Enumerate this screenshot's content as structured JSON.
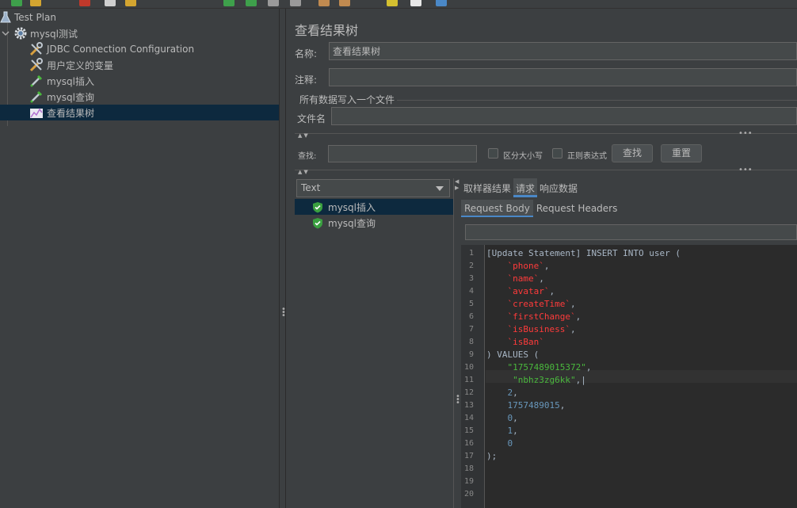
{
  "tree": {
    "items": [
      {
        "label": "Test Plan",
        "icon": "flask-icon"
      },
      {
        "label": "mysql测试",
        "icon": "gear-icon"
      },
      {
        "label": "JDBC Connection Configuration",
        "icon": "wrench-icon"
      },
      {
        "label": "用户定义的变量",
        "icon": "wrench-icon"
      },
      {
        "label": "mysql插入",
        "icon": "pipette-icon"
      },
      {
        "label": "mysql查询",
        "icon": "pipette-icon"
      },
      {
        "label": "查看结果树",
        "icon": "chart-icon"
      }
    ]
  },
  "panel": {
    "title": "查看结果树",
    "name_label": "名称:",
    "name_value": "查看结果树",
    "comment_label": "注释:",
    "comment_value": "",
    "file_group_label": "所有数据写入一个文件",
    "filename_label": "文件名",
    "filename_value": ""
  },
  "search": {
    "label": "查找:",
    "value": "",
    "case_label": "区分大小写",
    "regex_label": "正则表达式",
    "find_button": "查找",
    "reset_button": "重置"
  },
  "results": {
    "renderer": "Text",
    "items": [
      {
        "label": "mysql插入",
        "status": "success"
      },
      {
        "label": "mysql查询",
        "status": "success"
      }
    ]
  },
  "tabs": [
    {
      "label": "取样器结果",
      "active": false
    },
    {
      "label": "请求",
      "active": true
    },
    {
      "label": "响应数据",
      "active": false
    }
  ],
  "subtabs": [
    {
      "label": "Request Body",
      "active": true
    },
    {
      "label": "Request Headers",
      "active": false
    }
  ],
  "editor": {
    "lines": [
      {
        "n": "1",
        "parts": [
          {
            "t": "[Update Statement] INSERT INTO user (",
            "c": "plain"
          }
        ]
      },
      {
        "n": "2",
        "parts": [
          {
            "t": "    `phone`",
            "c": "red"
          },
          {
            "t": ",",
            "c": "plain"
          }
        ]
      },
      {
        "n": "3",
        "parts": [
          {
            "t": "    `name`",
            "c": "red"
          },
          {
            "t": ",",
            "c": "plain"
          }
        ]
      },
      {
        "n": "4",
        "parts": [
          {
            "t": "    `avatar`",
            "c": "red"
          },
          {
            "t": ",",
            "c": "plain"
          }
        ]
      },
      {
        "n": "5",
        "parts": [
          {
            "t": "    `createTime`",
            "c": "red"
          },
          {
            "t": ",",
            "c": "plain"
          }
        ]
      },
      {
        "n": "6",
        "parts": [
          {
            "t": "    `firstChange`",
            "c": "red"
          },
          {
            "t": ",",
            "c": "plain"
          }
        ]
      },
      {
        "n": "7",
        "parts": [
          {
            "t": "    `isBusiness`",
            "c": "red"
          },
          {
            "t": ",",
            "c": "plain"
          }
        ]
      },
      {
        "n": "8",
        "parts": [
          {
            "t": "    `isBan`",
            "c": "red"
          }
        ]
      },
      {
        "n": "9",
        "parts": [
          {
            "t": ") VALUES (",
            "c": "plain"
          }
        ]
      },
      {
        "n": "10",
        "parts": [
          {
            "t": "    \"1757489015372\"",
            "c": "green"
          },
          {
            "t": ",",
            "c": "plain"
          }
        ]
      },
      {
        "n": "11",
        "parts": [
          {
            "t": "     \"nbhz3zg6kk\"",
            "c": "green"
          },
          {
            "t": ",|",
            "c": "plain"
          }
        ]
      },
      {
        "n": "12",
        "parts": [
          {
            "t": "    2",
            "c": "num"
          },
          {
            "t": ",",
            "c": "plain"
          }
        ]
      },
      {
        "n": "13",
        "parts": [
          {
            "t": "    1757489015",
            "c": "num"
          },
          {
            "t": ",",
            "c": "plain"
          }
        ]
      },
      {
        "n": "14",
        "parts": [
          {
            "t": "    0",
            "c": "num"
          },
          {
            "t": ",",
            "c": "plain"
          }
        ]
      },
      {
        "n": "15",
        "parts": [
          {
            "t": "    1",
            "c": "num"
          },
          {
            "t": ",",
            "c": "plain"
          }
        ]
      },
      {
        "n": "16",
        "parts": [
          {
            "t": "    0",
            "c": "num"
          }
        ]
      },
      {
        "n": "17",
        "parts": [
          {
            "t": ");",
            "c": "plain"
          }
        ]
      },
      {
        "n": "18",
        "parts": []
      },
      {
        "n": "19",
        "parts": []
      },
      {
        "n": "20",
        "parts": []
      }
    ]
  },
  "colors": {
    "accent": "#4a88c7",
    "selection": "#0d293e",
    "string_red": "#ff3b3b",
    "string_green": "#4ab83d",
    "number": "#6897bb"
  }
}
